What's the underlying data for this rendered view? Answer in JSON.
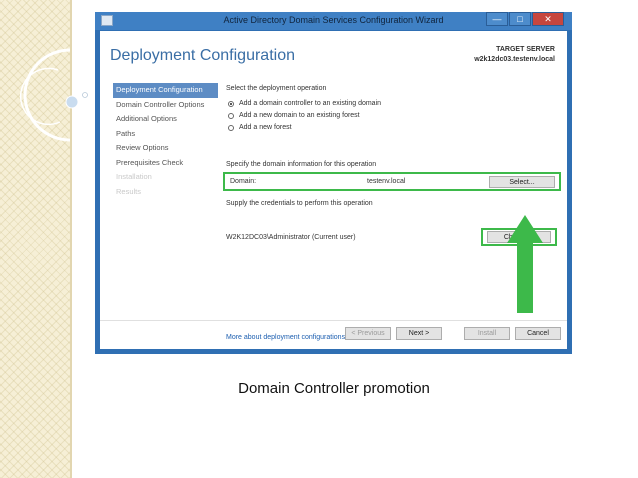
{
  "window": {
    "title": "Active Directory Domain Services Configuration Wizard",
    "controls": {
      "minimize": "—",
      "maximize": "□",
      "close": "✕"
    }
  },
  "page": {
    "title": "Deployment Configuration",
    "target_label": "TARGET SERVER",
    "target_server": "w2k12dc03.testenv.local"
  },
  "nav": {
    "items": [
      {
        "label": "Deployment Configuration",
        "state": "active"
      },
      {
        "label": "Domain Controller Options",
        "state": "normal"
      },
      {
        "label": "Additional Options",
        "state": "normal"
      },
      {
        "label": "Paths",
        "state": "normal"
      },
      {
        "label": "Review Options",
        "state": "normal"
      },
      {
        "label": "Prerequisites Check",
        "state": "normal"
      },
      {
        "label": "Installation",
        "state": "disabled"
      },
      {
        "label": "Results",
        "state": "disabled"
      }
    ]
  },
  "content": {
    "operation_label": "Select the deployment operation",
    "options": [
      {
        "label": "Add a domain controller to an existing domain",
        "selected": true
      },
      {
        "label": "Add a new domain to an existing forest",
        "selected": false
      },
      {
        "label": "Add a new forest",
        "selected": false
      }
    ],
    "domain_info_label": "Specify the domain information for this operation",
    "domain_label": "Domain:",
    "domain_value": "testenv.local",
    "select_button": "Select...",
    "credentials_label": "Supply the credentials to perform this operation",
    "credentials_value": "W2K12DC03\\Administrator (Current user)",
    "change_button": "Change...",
    "more_link": "More about deployment configurations"
  },
  "footer": {
    "previous": "< Previous",
    "next": "Next >",
    "install": "Install",
    "cancel": "Cancel"
  },
  "caption": "Domain Controller promotion",
  "colors": {
    "highlight_green": "#3db94a",
    "title_blue": "#3a6ea5",
    "window_blue": "#2f6fb3"
  }
}
